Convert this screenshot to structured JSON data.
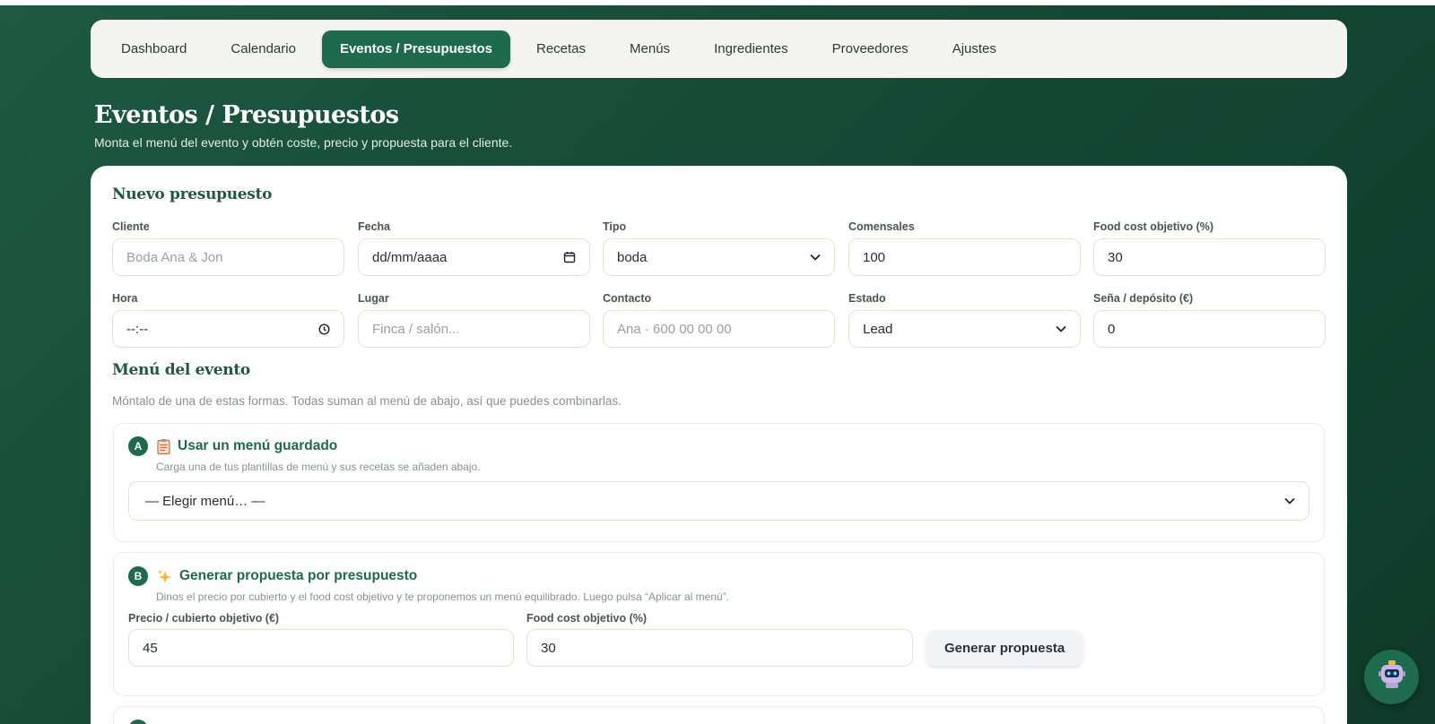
{
  "nav": {
    "items": [
      {
        "label": "Dashboard"
      },
      {
        "label": "Calendario"
      },
      {
        "label": "Eventos / Presupuestos"
      },
      {
        "label": "Recetas"
      },
      {
        "label": "Menús"
      },
      {
        "label": "Ingredientes"
      },
      {
        "label": "Proveedores"
      },
      {
        "label": "Ajustes"
      }
    ],
    "active_index": 2
  },
  "header": {
    "title": "Eventos / Presupuestos",
    "subtitle": "Monta el menú del evento y obtén coste, precio y propuesta para el cliente."
  },
  "form": {
    "title": "Nuevo presupuesto",
    "cliente": {
      "label": "Cliente",
      "placeholder": "Boda Ana & Jon"
    },
    "fecha": {
      "label": "Fecha",
      "value": "dd/mm/aaaa"
    },
    "tipo": {
      "label": "Tipo",
      "value": "boda"
    },
    "comensales": {
      "label": "Comensales",
      "value": "100"
    },
    "food_cost": {
      "label": "Food cost objetivo (%)",
      "value": "30"
    },
    "hora": {
      "label": "Hora",
      "value": "--:--"
    },
    "lugar": {
      "label": "Lugar",
      "placeholder": "Finca / salón..."
    },
    "contacto": {
      "label": "Contacto",
      "placeholder": "Ana · 600 00 00 00"
    },
    "estado": {
      "label": "Estado",
      "value": "Lead"
    },
    "sena": {
      "label": "Seña / depósito (€)",
      "value": "0"
    }
  },
  "menu": {
    "title": "Menú del evento",
    "hint": "Móntalo de una de estas formas. Todas suman al menú de abajo, así que puedes combinarlas.",
    "option_a": {
      "badge": "A",
      "title": "Usar un menú guardado",
      "desc": "Carga una de tus plantillas de menú y sus recetas se añaden abajo.",
      "select_value": "— Elegir menú… —"
    },
    "option_b": {
      "badge": "B",
      "title": "Generar propuesta por presupuesto",
      "desc": "Dinos el precio por cubierto y el food cost objetivo y te proponemos un menú equilibrado. Luego pulsa “Aplicar al menú”.",
      "precio_label": "Precio / cubierto objetivo (€)",
      "precio_value": "45",
      "fc_label": "Food cost objetivo (%)",
      "fc_value": "30",
      "button": "Generar propuesta"
    }
  },
  "colors": {
    "accent": "#1e6a4e",
    "background": "#164a37",
    "field_border": "#e8e2cf"
  },
  "icons": [
    "calendar-icon",
    "chevron-down-icon",
    "clock-icon",
    "clipboard-icon",
    "sparkles-icon",
    "robot-icon"
  ]
}
